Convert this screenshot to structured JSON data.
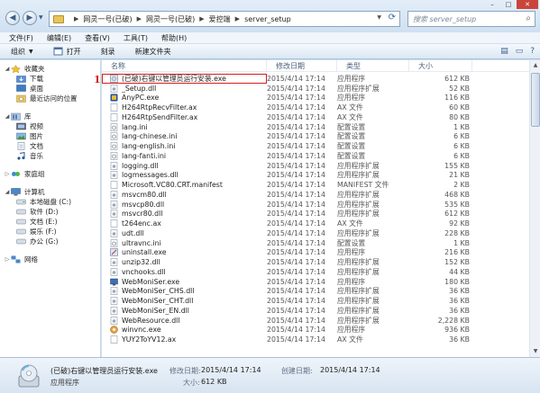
{
  "address": {
    "crumbs": [
      "网灵一号(已破)",
      "网灵一号(已破)",
      "爱控端",
      "server_setup"
    ],
    "search_placeholder": "搜索 server_setup"
  },
  "menu": [
    "文件(F)",
    "编辑(E)",
    "查看(V)",
    "工具(T)",
    "帮助(H)"
  ],
  "toolbar": {
    "organize": "组织",
    "open": "打开",
    "burn": "刻录",
    "new_folder": "新建文件夹"
  },
  "sidebar": {
    "favorites": "收藏夹",
    "fav_items": [
      "下载",
      "桌面",
      "最近访问的位置"
    ],
    "library": "库",
    "lib_items": [
      "视频",
      "图片",
      "文档",
      "音乐"
    ],
    "homegroup": "家庭组",
    "computer": "计算机",
    "drives": [
      "本地磁盘 (C:)",
      "软件 (D:)",
      "文档 (E:)",
      "娱乐 (F:)",
      "办公 (G:)"
    ],
    "network": "网络"
  },
  "columns": {
    "name": "名称",
    "date": "修改日期",
    "type": "类型",
    "size": "大小"
  },
  "annotation": "1",
  "files": [
    {
      "name": "(已破)右键以管理员运行安装.exe",
      "date": "2015/4/14 17:14",
      "type": "应用程序",
      "size": "612 KB",
      "icon": "setup-exe-icon",
      "selected": true
    },
    {
      "name": "_Setup.dll",
      "date": "2015/4/14 17:14",
      "type": "应用程序扩展",
      "size": "52 KB",
      "icon": "dll-icon"
    },
    {
      "name": "AnyPC.exe",
      "date": "2015/4/14 17:14",
      "type": "应用程序",
      "size": "116 KB",
      "icon": "anypc-exe-icon"
    },
    {
      "name": "H264RtpRecvFilter.ax",
      "date": "2015/4/14 17:14",
      "type": "AX 文件",
      "size": "60 KB",
      "icon": "ax-file-icon"
    },
    {
      "name": "H264RtpSendFilter.ax",
      "date": "2015/4/14 17:14",
      "type": "AX 文件",
      "size": "80 KB",
      "icon": "ax-file-icon"
    },
    {
      "name": "lang.ini",
      "date": "2015/4/14 17:14",
      "type": "配置设置",
      "size": "1 KB",
      "icon": "ini-icon"
    },
    {
      "name": "lang-chinese.ini",
      "date": "2015/4/14 17:14",
      "type": "配置设置",
      "size": "6 KB",
      "icon": "ini-icon"
    },
    {
      "name": "lang-english.ini",
      "date": "2015/4/14 17:14",
      "type": "配置设置",
      "size": "6 KB",
      "icon": "ini-icon"
    },
    {
      "name": "lang-fanti.ini",
      "date": "2015/4/14 17:14",
      "type": "配置设置",
      "size": "6 KB",
      "icon": "ini-icon"
    },
    {
      "name": "logging.dll",
      "date": "2015/4/14 17:14",
      "type": "应用程序扩展",
      "size": "155 KB",
      "icon": "dll-icon"
    },
    {
      "name": "logmessages.dll",
      "date": "2015/4/14 17:14",
      "type": "应用程序扩展",
      "size": "21 KB",
      "icon": "dll-icon"
    },
    {
      "name": "Microsoft.VC80.CRT.manifest",
      "date": "2015/4/14 17:14",
      "type": "MANIFEST 文件",
      "size": "2 KB",
      "icon": "manifest-file-icon"
    },
    {
      "name": "msvcm80.dll",
      "date": "2015/4/14 17:14",
      "type": "应用程序扩展",
      "size": "468 KB",
      "icon": "dll-icon"
    },
    {
      "name": "msvcp80.dll",
      "date": "2015/4/14 17:14",
      "type": "应用程序扩展",
      "size": "535 KB",
      "icon": "dll-icon"
    },
    {
      "name": "msvcr80.dll",
      "date": "2015/4/14 17:14",
      "type": "应用程序扩展",
      "size": "612 KB",
      "icon": "dll-icon"
    },
    {
      "name": "t264enc.ax",
      "date": "2015/4/14 17:14",
      "type": "AX 文件",
      "size": "92 KB",
      "icon": "ax-file-icon"
    },
    {
      "name": "udt.dll",
      "date": "2015/4/14 17:14",
      "type": "应用程序扩展",
      "size": "228 KB",
      "icon": "dll-icon"
    },
    {
      "name": "ultravnc.ini",
      "date": "2015/4/14 17:14",
      "type": "配置设置",
      "size": "1 KB",
      "icon": "ini-icon"
    },
    {
      "name": "uninstall.exe",
      "date": "2015/4/14 17:14",
      "type": "应用程序",
      "size": "216 KB",
      "icon": "uninstall-exe-icon"
    },
    {
      "name": "unzip32.dll",
      "date": "2015/4/14 17:14",
      "type": "应用程序扩展",
      "size": "152 KB",
      "icon": "dll-icon"
    },
    {
      "name": "vnchooks.dll",
      "date": "2015/4/14 17:14",
      "type": "应用程序扩展",
      "size": "44 KB",
      "icon": "dll-icon"
    },
    {
      "name": "WebMoniSer.exe",
      "date": "2015/4/14 17:14",
      "type": "应用程序",
      "size": "180 KB",
      "icon": "webmoniser-exe-icon"
    },
    {
      "name": "WebMoniSer_CHS.dll",
      "date": "2015/4/14 17:14",
      "type": "应用程序扩展",
      "size": "36 KB",
      "icon": "dll-icon"
    },
    {
      "name": "WebMoniSer_CHT.dll",
      "date": "2015/4/14 17:14",
      "type": "应用程序扩展",
      "size": "36 KB",
      "icon": "dll-icon"
    },
    {
      "name": "WebMoniSer_EN.dll",
      "date": "2015/4/14 17:14",
      "type": "应用程序扩展",
      "size": "36 KB",
      "icon": "dll-icon"
    },
    {
      "name": "WebResource.dll",
      "date": "2015/4/14 17:14",
      "type": "应用程序扩展",
      "size": "2,228 KB",
      "icon": "dll-icon"
    },
    {
      "name": "winvnc.exe",
      "date": "2015/4/14 17:14",
      "type": "应用程序",
      "size": "936 KB",
      "icon": "winvnc-exe-icon"
    },
    {
      "name": "YUY2ToYV12.ax",
      "date": "2015/4/14 17:14",
      "type": "AX 文件",
      "size": "36 KB",
      "icon": "ax-file-icon"
    }
  ],
  "details": {
    "name": "(已破)右键以管理员运行安装.exe",
    "type": "应用程序",
    "modified_label": "修改日期:",
    "modified": "2015/4/14 17:14",
    "created_label": "创建日期:",
    "created": "2015/4/14 17:14",
    "size_label": "大小:",
    "size": "612 KB"
  }
}
